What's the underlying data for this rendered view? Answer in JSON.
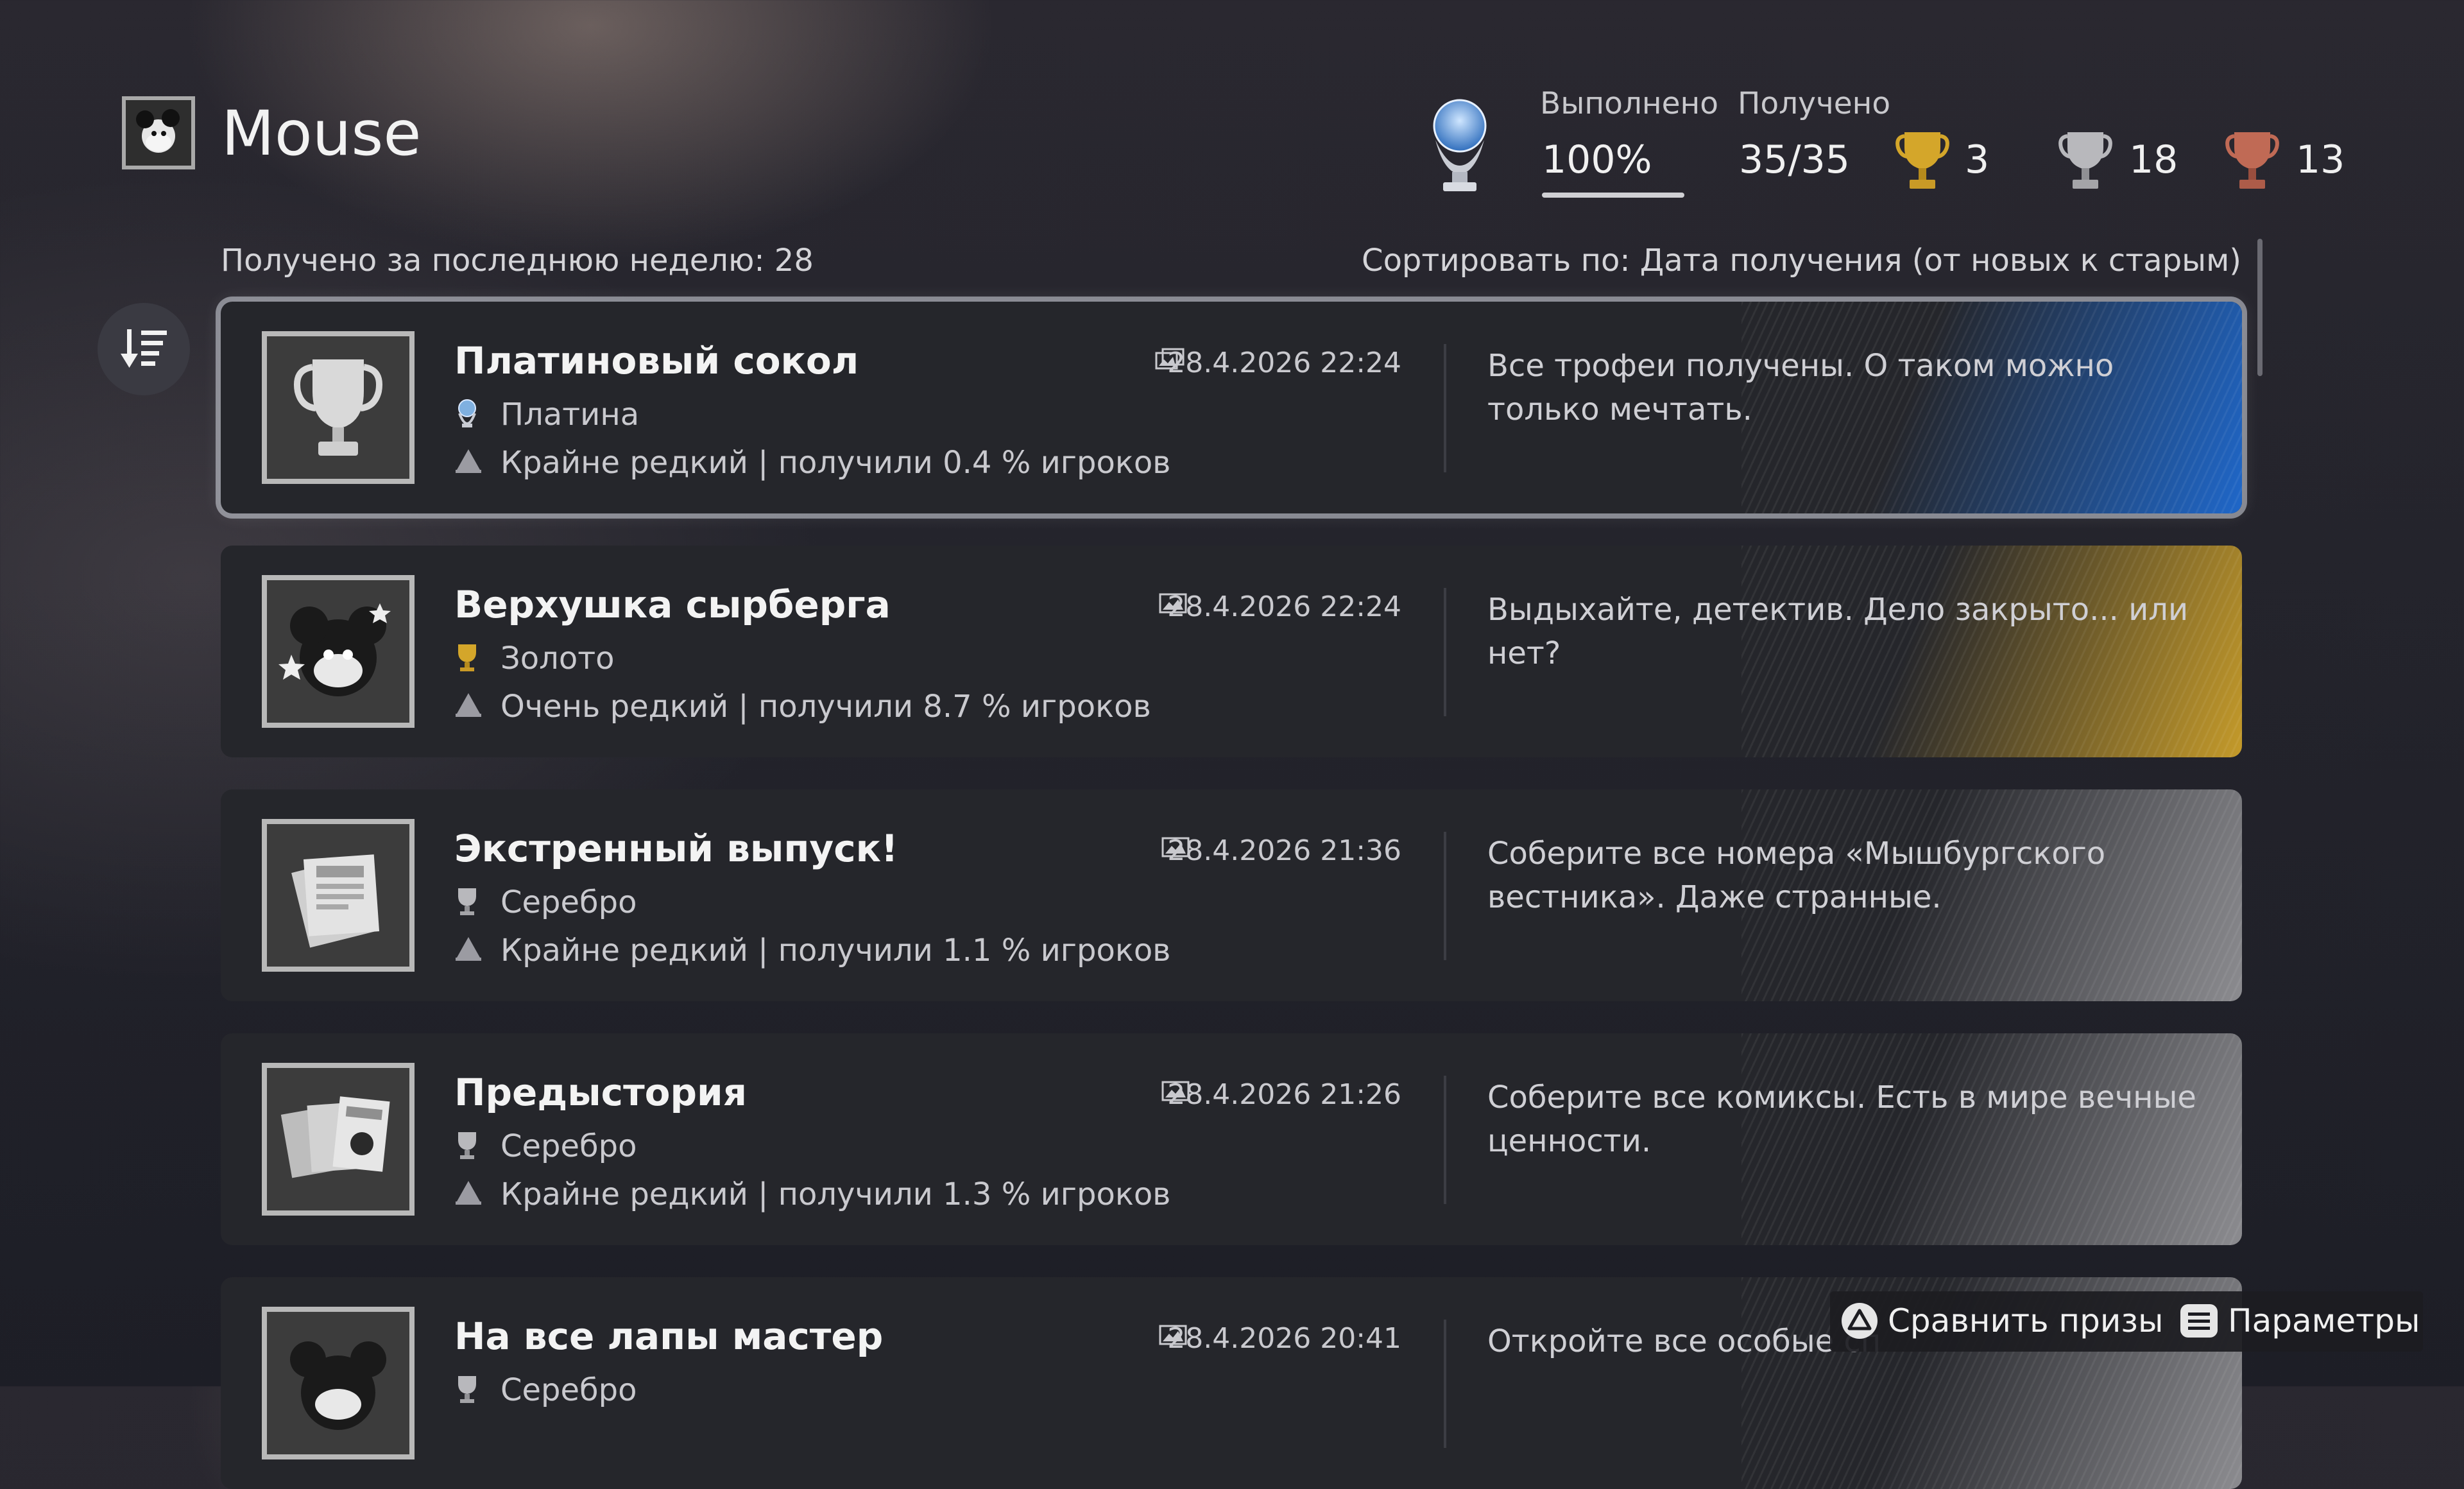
{
  "header": {
    "game_title": "Mouse",
    "completed_label": "Выполнено",
    "completed_value": "100%",
    "earned_label": "Получено",
    "earned_value": "35/35",
    "gold_count": "3",
    "silver_count": "18",
    "bronze_count": "13"
  },
  "list_info": {
    "week_summary": "Получено за последнюю неделю: 28",
    "sort_by": "Сортировать по: Дата получения (от новых к старым)"
  },
  "trophies": [
    {
      "name": "Платиновый сокол",
      "grade": "Платина",
      "grade_icon": "platinum-trophy-icon",
      "rarity": "Крайне редкий | получили 0.4 % игроков",
      "date": "28.4.2026  22:24",
      "description": "Все трофеи получены. О таком можно только мечтать.",
      "accent": "#1f67c9"
    },
    {
      "name": "Верхушка сырберга",
      "grade": "Золото",
      "grade_icon": "gold-trophy-icon",
      "rarity": "Очень редкий | получили 8.7 % игроков",
      "date": "28.4.2026  22:24",
      "description": "Выдыхайте, детектив. Дело закрыто... или нет?",
      "accent": "#c49a2a"
    },
    {
      "name": "Экстренный выпуск!",
      "grade": "Серебро",
      "grade_icon": "silver-trophy-icon",
      "rarity": "Крайне редкий | получили 1.1 % игроков",
      "date": "28.4.2026  21:36",
      "description": "Соберите все номера «Мышбургского вестника». Даже странные.",
      "accent": "#8c8c90"
    },
    {
      "name": "Предыстория",
      "grade": "Серебро",
      "grade_icon": "silver-trophy-icon",
      "rarity": "Крайне редкий | получили 1.3 % игроков",
      "date": "28.4.2026  21:26",
      "description": "Соберите все комиксы. Есть в мире вечные ценности.",
      "accent": "#8c8c90"
    },
    {
      "name": "На все лапы мастер",
      "grade": "Серебро",
      "grade_icon": "silver-trophy-icon",
      "rarity": "",
      "date": "28.4.2026  20:41",
      "description": "Откройте все особые сп",
      "accent": "#8c8c90"
    }
  ],
  "footer": {
    "compare_label": "Сравнить призы",
    "options_label": "Параметры"
  },
  "colors": {
    "platinum": "#7fb0e0",
    "gold": "#d4a62a",
    "silver": "#b8b8bc",
    "bronze": "#c06a55"
  }
}
